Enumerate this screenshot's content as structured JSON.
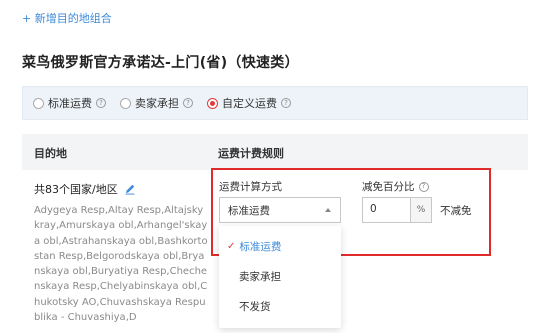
{
  "header": {
    "add_link": "+ 新增目的地组合",
    "title": "菜鸟俄罗斯官方承诺达-上门(省)（快速类）"
  },
  "shipping_options": [
    {
      "label": "标准运费",
      "selected": false
    },
    {
      "label": "卖家承担",
      "selected": false
    },
    {
      "label": "自定义运费",
      "selected": true
    }
  ],
  "table": {
    "col_destination": "目的地",
    "col_rule": "运费计费规则"
  },
  "destination": {
    "count_label": "共83个国家/地区",
    "list_text": "Adygeya Resp,Altay Resp,Altajsky kray,Amurskaya obl,Arhangel'skaya obl,Astrahanskaya obl,Bashkortostan Resp,Belgorodskaya obl,Bryanskaya obl,Buryatiya Resp,Chechenskaya Resp,Chelyabinskaya obl,Chukotsky AO,Chuvashskaya Respublika - Chuvashiya,D"
  },
  "rule": {
    "method_label": "运费计算方式",
    "method_value": "标准运费",
    "discount_label": "减免百分比",
    "discount_value": "0",
    "discount_unit": "%",
    "no_discount_label": "不减免",
    "dropdown_options": [
      "标准运费",
      "卖家承担",
      "不发货"
    ],
    "dropdown_selected_index": 0
  },
  "colors": {
    "accent_blue": "#3d8ad8",
    "highlight_red": "#e02b2b",
    "radio_red": "#e23a3a"
  }
}
